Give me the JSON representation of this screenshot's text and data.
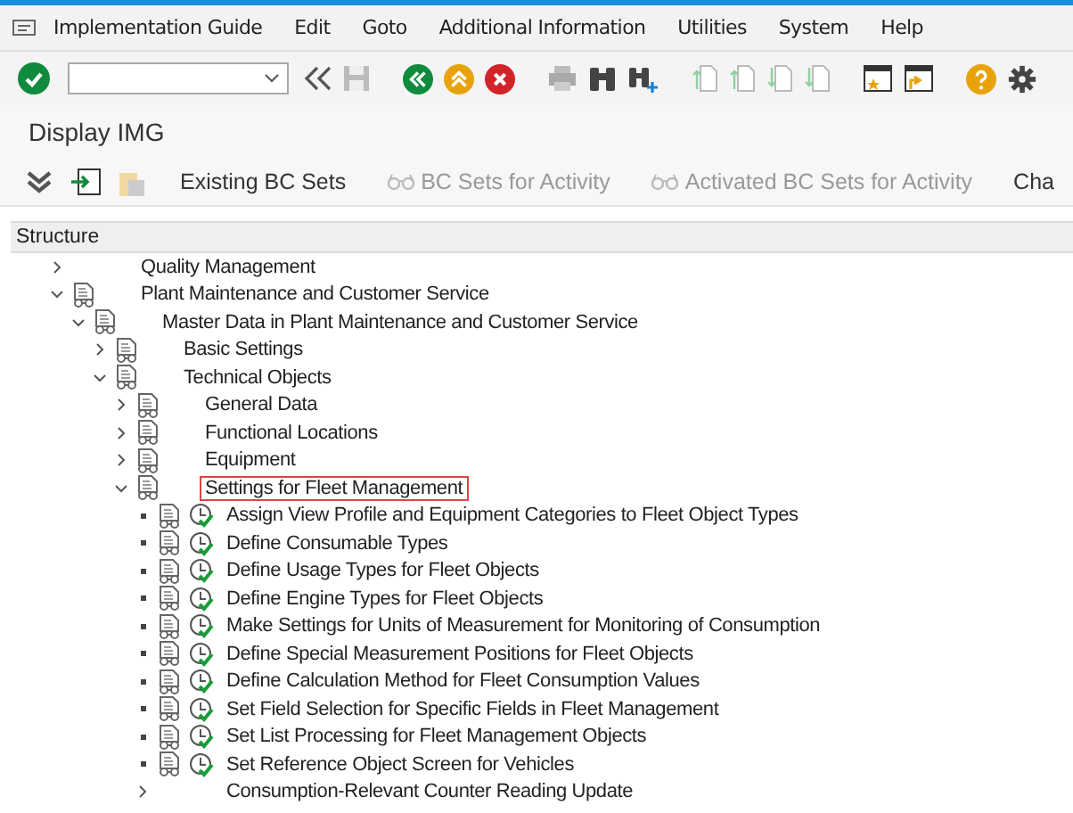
{
  "menu_bar": {
    "items": [
      "Implementation Guide",
      "Edit",
      "Goto",
      "Additional Information",
      "Utilities",
      "System",
      "Help"
    ]
  },
  "title": "Display IMG",
  "app_toolbar": {
    "buttons": [
      {
        "label": "Existing BC Sets",
        "disabled": false,
        "glasses": false
      },
      {
        "label": "BC Sets for Activity",
        "disabled": true,
        "glasses": true
      },
      {
        "label": "Activated BC Sets for Activity",
        "disabled": true,
        "glasses": true
      },
      {
        "label": "Cha",
        "disabled": false,
        "glasses": false
      }
    ]
  },
  "tree": {
    "header": "Structure",
    "nodes": [
      {
        "kind": "label",
        "label": "Quality Management",
        "expanded": false,
        "selected": false
      },
      {
        "kind": "structure",
        "label": "Plant Maintenance and Customer Service",
        "expanded": true,
        "selected": false,
        "children": [
          {
            "kind": "structure",
            "label": "Master Data in Plant Maintenance and Customer Service",
            "expanded": true,
            "selected": false,
            "children": [
              {
                "kind": "structure",
                "label": "Basic Settings",
                "expanded": false,
                "selected": false
              },
              {
                "kind": "structure",
                "label": "Technical Objects",
                "expanded": true,
                "selected": false,
                "children": [
                  {
                    "kind": "structure",
                    "label": "General Data",
                    "expanded": false,
                    "selected": false
                  },
                  {
                    "kind": "structure",
                    "label": "Functional Locations",
                    "expanded": false,
                    "selected": false
                  },
                  {
                    "kind": "structure",
                    "label": "Equipment",
                    "expanded": false,
                    "selected": false
                  },
                  {
                    "kind": "structure",
                    "label": "Settings for Fleet Management",
                    "expanded": true,
                    "selected": true,
                    "children": [
                      {
                        "kind": "activity",
                        "label": "Assign View Profile and Equipment Categories to Fleet Object Types",
                        "selected": false
                      },
                      {
                        "kind": "activity",
                        "label": "Define Consumable Types",
                        "selected": false
                      },
                      {
                        "kind": "activity",
                        "label": "Define Usage Types for Fleet Objects",
                        "selected": false
                      },
                      {
                        "kind": "activity",
                        "label": "Define Engine Types for Fleet Objects",
                        "selected": false
                      },
                      {
                        "kind": "activity",
                        "label": "Make Settings for Units of Measurement for Monitoring of Consumption",
                        "selected": false
                      },
                      {
                        "kind": "activity",
                        "label": "Define Special Measurement Positions for Fleet Objects",
                        "selected": false
                      },
                      {
                        "kind": "activity",
                        "label": "Define Calculation Method for Fleet Consumption Values",
                        "selected": false
                      },
                      {
                        "kind": "activity",
                        "label": "Set Field Selection for Specific Fields in Fleet Management",
                        "selected": false
                      },
                      {
                        "kind": "activity",
                        "label": "Set List Processing for Fleet Management Objects",
                        "selected": false
                      },
                      {
                        "kind": "activity",
                        "label": "Set Reference Object Screen for Vehicles",
                        "selected": false
                      },
                      {
                        "kind": "label",
                        "label": "Consumption-Relevant Counter Reading Update",
                        "expanded": false,
                        "selected": false
                      }
                    ]
                  }
                ]
              }
            ]
          }
        ]
      }
    ]
  }
}
